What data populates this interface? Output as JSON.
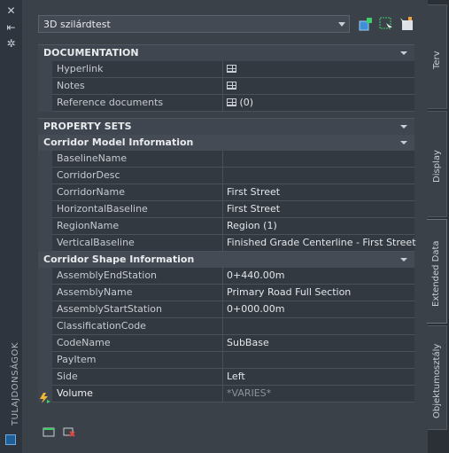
{
  "palette_title": "TULAJDONSÁGOK",
  "style_select": {
    "value": "3D szilárdtest"
  },
  "sections": {
    "documentation": {
      "title": "DOCUMENTATION",
      "rows": [
        {
          "name": "Hyperlink",
          "value": ""
        },
        {
          "name": "Notes",
          "value": ""
        },
        {
          "name": "Reference documents",
          "value": "(0)"
        }
      ]
    },
    "property_sets": {
      "title": "PROPERTY SETS"
    },
    "corridor_model": {
      "title": "Corridor Model Information",
      "rows": [
        {
          "name": "BaselineName",
          "value": ""
        },
        {
          "name": "CorridorDesc",
          "value": ""
        },
        {
          "name": "CorridorName",
          "value": "First Street"
        },
        {
          "name": "HorizontalBaseline",
          "value": "First Street"
        },
        {
          "name": "RegionName",
          "value": "Region (1)"
        },
        {
          "name": "VerticalBaseline",
          "value": "Finished Grade Centerline - First Street"
        }
      ]
    },
    "corridor_shape": {
      "title": "Corridor Shape Information",
      "rows": [
        {
          "name": "AssemblyEndStation",
          "value": "0+440.00m"
        },
        {
          "name": "AssemblyName",
          "value": "Primary Road Full Section"
        },
        {
          "name": "AssemblyStartStation",
          "value": "0+000.00m"
        },
        {
          "name": "ClassificationCode",
          "value": ""
        },
        {
          "name": "CodeName",
          "value": "SubBase"
        },
        {
          "name": "PayItem",
          "value": ""
        },
        {
          "name": "Side",
          "value": "Left"
        },
        {
          "name": "Volume",
          "value": "*VARIES*"
        }
      ]
    }
  },
  "tabs": [
    {
      "label": "Terv"
    },
    {
      "label": "Display"
    },
    {
      "label": "Extended Data"
    },
    {
      "label": "Objektumosztály"
    }
  ],
  "icons": {
    "close": "close-icon",
    "pin": "auto-hide-icon",
    "settings": "properties-menu-icon"
  }
}
